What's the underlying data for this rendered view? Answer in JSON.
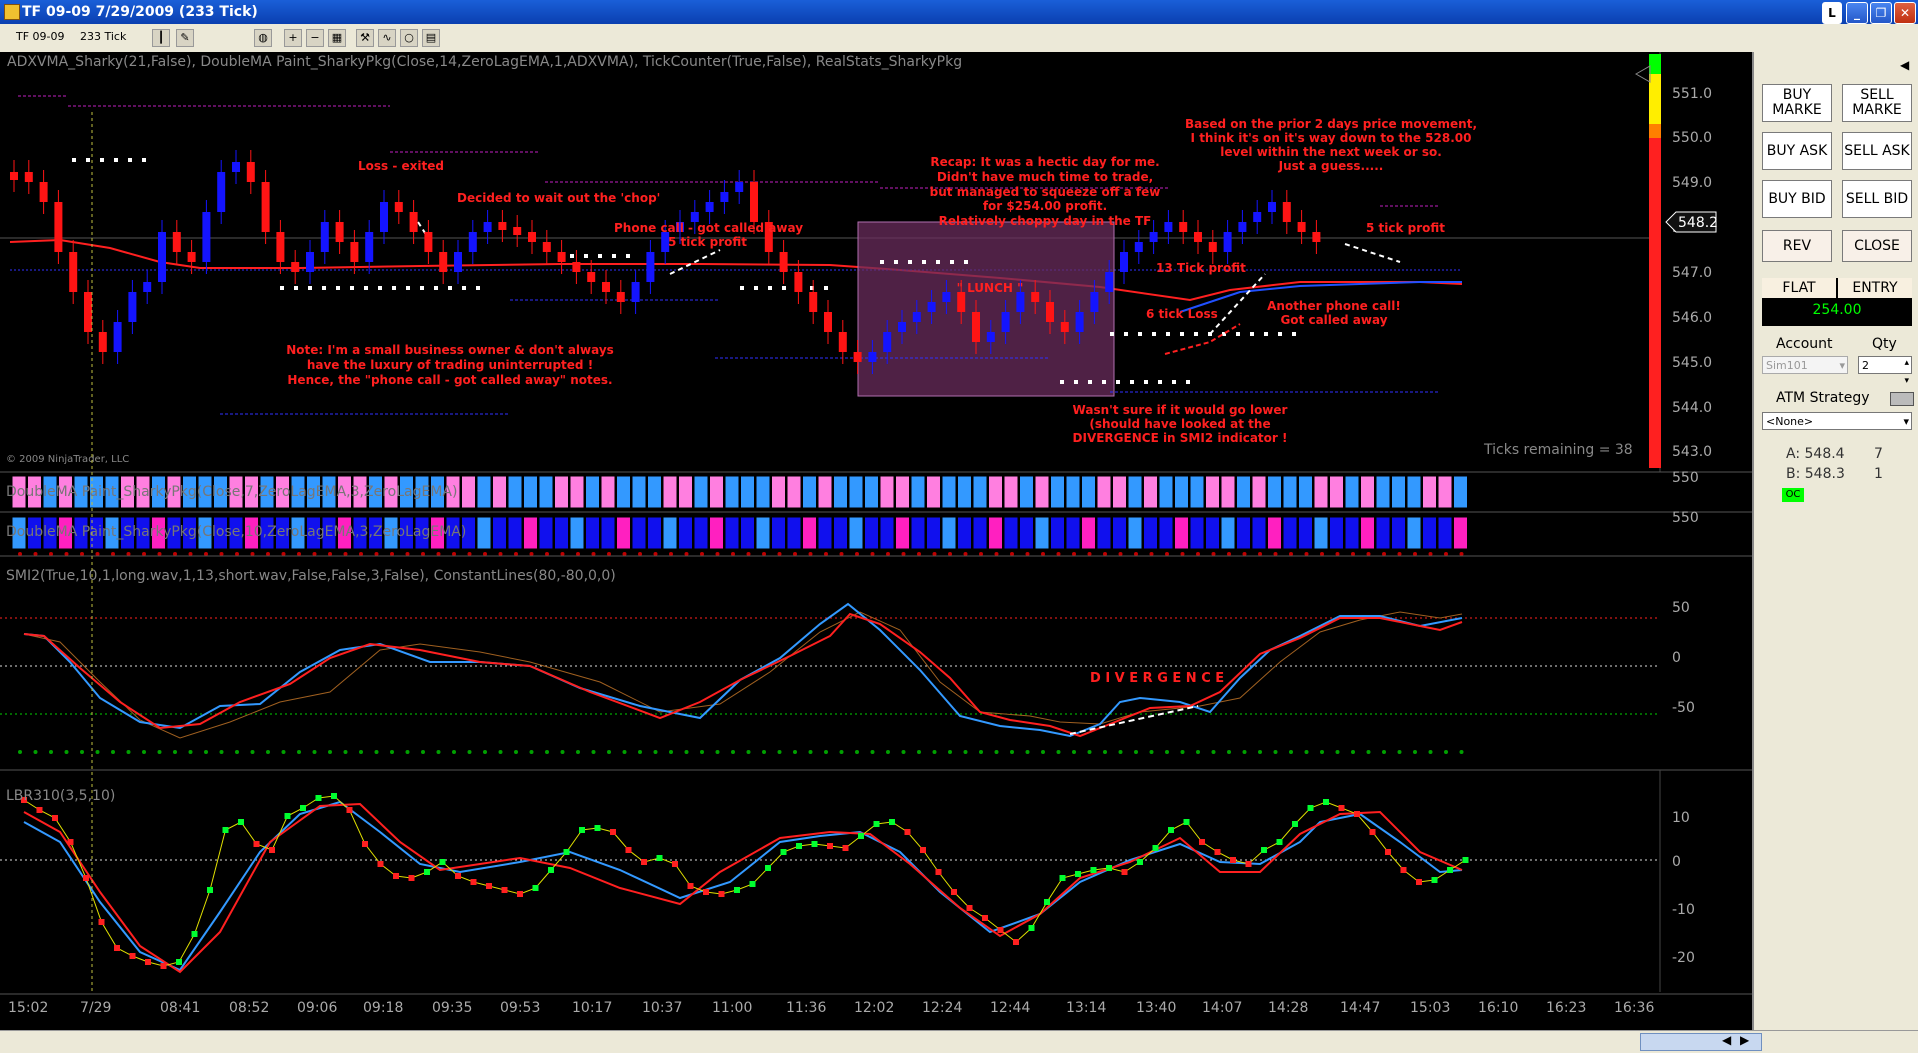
{
  "window": {
    "title": "TF 09-09  7/29/2009 (233 Tick)"
  },
  "toolbar": {
    "instrument": "TF 09-09",
    "interval": "233 Tick"
  },
  "chart": {
    "indicators_label": "ADXVMA_Sharky(21,False),  DoubleMA  Paint_SharkyPkg(Close,14,ZeroLagEMA,1,ADXVMA),  TickCounter(True,False),  RealStats_SharkyPkg",
    "copyright": "© 2009 NinjaTrader, LLC",
    "ticks_remaining": "Ticks remaining = 38",
    "last_price": "548.2",
    "price_axis": [
      "551.0",
      "550.0",
      "549.0",
      "548.0",
      "547.0",
      "546.0",
      "545.0",
      "544.0",
      "543.0"
    ],
    "annotations": {
      "loss_exited": "Loss - exited",
      "wait_chop": "Decided to wait out the 'chop'",
      "phone_call": "Phone call - got called away",
      "five_tick_1": "5 tick profit",
      "recap_1": "Recap: It was a hectic day for me.",
      "recap_2": "Didn't have much time to trade,",
      "recap_3": "but managed to squeeze off a few",
      "recap_4": "for $254.00 profit.",
      "recap_5": "Relatively choppy day in the TF",
      "lunch": "\" LUNCH \"",
      "note_1": "Note: I'm a small business owner & don't always",
      "note_2": "have the luxury of trading uninterrupted !",
      "note_3": "Hence, the \"phone call - got called away\" notes.",
      "thirteen_tick": "13 Tick profit",
      "six_tick_loss": "6 tick Loss",
      "another_call_1": "Another phone call!",
      "another_call_2": "Got called away",
      "five_tick_2": "5 tick profit",
      "based_1": "Based on the prior 2 days price movement,",
      "based_2": "I think it's on it's way down to the 528.00",
      "based_3": "level within the next week or so.",
      "based_4": "Just a guess.....",
      "wasnt_1": "Wasn't sure if it would go lower",
      "wasnt_2": "(should have looked at the",
      "wasnt_3": "DIVERGENCE in SMI2 indicator !",
      "divergence": "D I V E R G E N C E"
    },
    "paint1_label": "DoubleMA  Paint_SharkyPkg(Close,7,ZeroLagEMA,3,ZeroLagEMA)",
    "paint1_axis": "550",
    "paint2_label": "DoubleMA  Paint_SharkyPkg(Close,10,ZeroLagEMA,3,ZeroLagEMA)",
    "paint2_axis": "550",
    "smi_label": "SMI2(True,10,1,long.wav,1,13,short.wav,False,False,3,False),  ConstantLines(80,-80,0,0)",
    "smi_axis": [
      "50",
      "0",
      "-50"
    ],
    "lbr_label": "LBR310(3,5,10)",
    "lbr_axis": [
      "10",
      "0",
      "-10",
      "-20"
    ],
    "time_axis": [
      "15:02",
      "7/29",
      "08:41",
      "08:52",
      "09:06",
      "09:18",
      "09:35",
      "09:53",
      "10:17",
      "10:37",
      "11:00",
      "11:36",
      "12:02",
      "12:24",
      "12:44",
      "13:14",
      "13:40",
      "14:07",
      "14:28",
      "14:47",
      "15:03",
      "16:10",
      "16:23",
      "16:36"
    ]
  },
  "panel": {
    "buy_market": "BUY MARKE",
    "sell_market": "SELL MARKE",
    "buy_ask": "BUY ASK",
    "sell_ask": "SELL ASK",
    "buy_bid": "BUY BID",
    "sell_bid": "SELL BID",
    "rev": "REV",
    "close": "CLOSE",
    "flat": "FLAT",
    "entry": "ENTRY",
    "pnl": "254.00",
    "account_label": "Account",
    "qty_label": "Qty",
    "account_value": "Sim101",
    "qty_value": "2",
    "atm_label": "ATM Strategy",
    "atm_value": "<None>",
    "ask_label": "A: 548.4",
    "ask_size": "7",
    "bid_label": "B: 548.3",
    "bid_size": "1",
    "oc_badge": "OC"
  },
  "colors": {
    "up_candle": "#1414ff",
    "down_candle": "#ff1414",
    "annotation": "#ff2020",
    "smi_fast": "#3399ff",
    "smi_slow": "#ff2020",
    "pink_bar": "#ff7fe0",
    "blue_bar": "#3399ff",
    "magenta_bar": "#ff20c0"
  }
}
